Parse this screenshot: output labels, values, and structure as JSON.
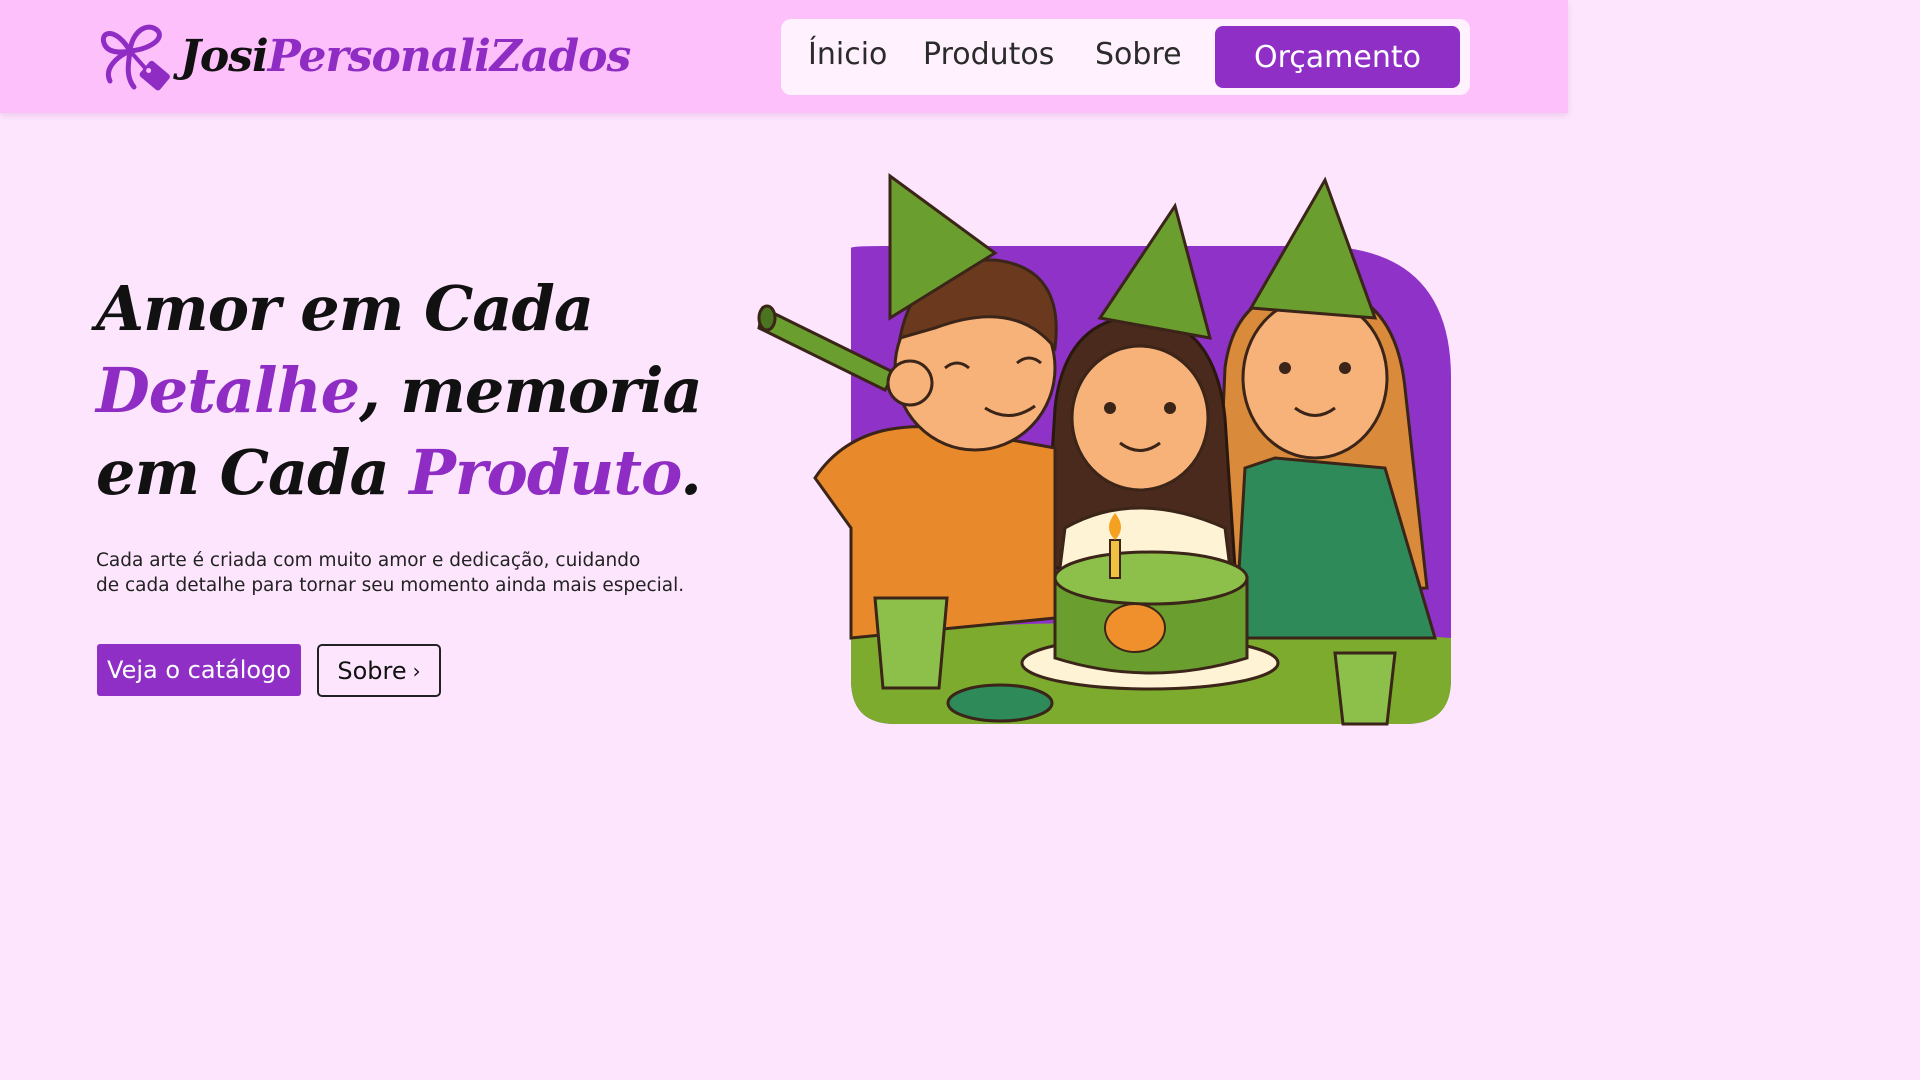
{
  "brand": {
    "part1": "Josi",
    "part2": "PersonaliZados",
    "icon": "bow-tag-icon",
    "color_primary": "#8f2fc6"
  },
  "nav": {
    "items": [
      {
        "label": "Ínicio"
      },
      {
        "label": "Produtos"
      },
      {
        "label": "Sobre"
      }
    ],
    "cta_label": "Orçamento"
  },
  "hero": {
    "line1": "Amor em Cada",
    "line2_highlight": "Detalhe",
    "line2_rest": ", memoria",
    "line3_start": "em Cada ",
    "line3_highlight": "Produto",
    "line3_end": ".",
    "paragraph_line1": "Cada arte é criada com muito amor e dedicação, cuidando",
    "paragraph_line2": "de cada detalhe para tornar seu momento ainda mais especial.",
    "primary_button": "Veja o catálogo",
    "secondary_button": "Sobre",
    "secondary_icon": "chevron-right-icon"
  },
  "colors": {
    "header_bg": "#fdc0fb",
    "page_bg": "#fde6fd",
    "accent": "#8e2cc4"
  }
}
